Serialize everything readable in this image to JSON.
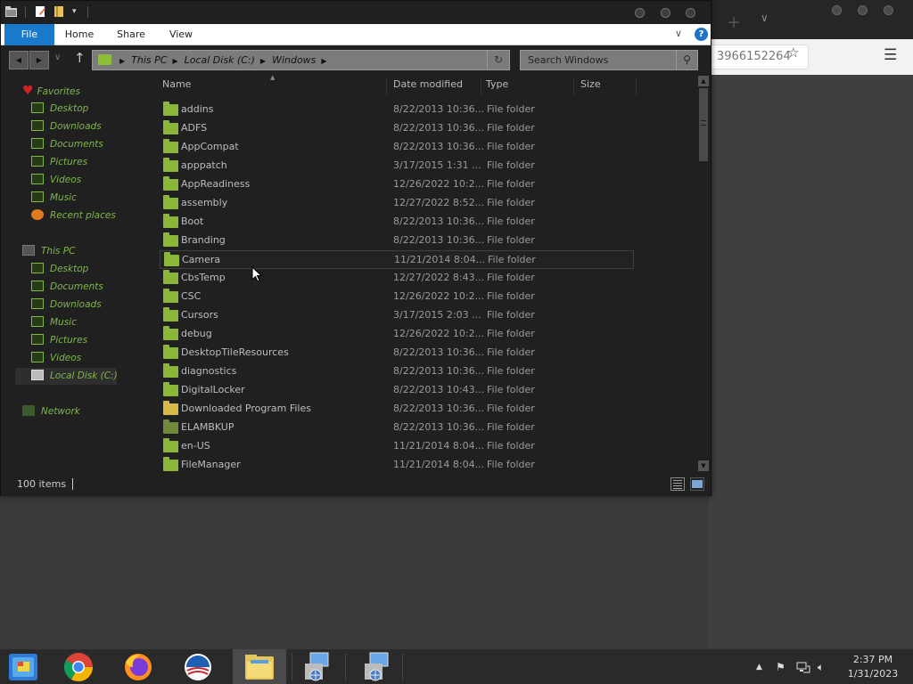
{
  "browser": {
    "url_fragment": "3966152264",
    "new_tab_icon": "plus-icon",
    "tab_list_icon": "chevron-down-icon",
    "bookmark_icon": "star-icon",
    "menu_icon": "hamburger-icon"
  },
  "explorer": {
    "ribbon_tabs": [
      "File",
      "Home",
      "Share",
      "View"
    ],
    "help_label": "?",
    "address": {
      "crumbs": [
        "This PC",
        "Local Disk (C:)",
        "Windows"
      ]
    },
    "search": {
      "placeholder": "Search Windows"
    },
    "nav": {
      "favorites": {
        "label": "Favorites",
        "items": [
          "Desktop",
          "Downloads",
          "Documents",
          "Pictures",
          "Videos",
          "Music",
          "Recent places"
        ]
      },
      "this_pc": {
        "label": "This PC",
        "items": [
          "Desktop",
          "Documents",
          "Downloads",
          "Music",
          "Pictures",
          "Videos",
          "Local Disk (C:)"
        ]
      },
      "network": {
        "label": "Network"
      }
    },
    "columns": {
      "name": "Name",
      "date": "Date modified",
      "type": "Type",
      "size": "Size"
    },
    "files": [
      {
        "name": "addins",
        "date": "8/22/2013 10:36...",
        "type": "File folder",
        "icon": "folder"
      },
      {
        "name": "ADFS",
        "date": "8/22/2013 10:36...",
        "type": "File folder",
        "icon": "folder"
      },
      {
        "name": "AppCompat",
        "date": "8/22/2013 10:36...",
        "type": "File folder",
        "icon": "folder"
      },
      {
        "name": "apppatch",
        "date": "3/17/2015 1:31 ...",
        "type": "File folder",
        "icon": "folder"
      },
      {
        "name": "AppReadiness",
        "date": "12/26/2022 10:2...",
        "type": "File folder",
        "icon": "folder"
      },
      {
        "name": "assembly",
        "date": "12/27/2022 8:52...",
        "type": "File folder",
        "icon": "folder"
      },
      {
        "name": "Boot",
        "date": "8/22/2013 10:36...",
        "type": "File folder",
        "icon": "folder"
      },
      {
        "name": "Branding",
        "date": "8/22/2013 10:36...",
        "type": "File folder",
        "icon": "folder"
      },
      {
        "name": "Camera",
        "date": "11/21/2014 8:04...",
        "type": "File folder",
        "icon": "folder"
      },
      {
        "name": "CbsTemp",
        "date": "12/27/2022 8:43...",
        "type": "File folder",
        "icon": "folder"
      },
      {
        "name": "CSC",
        "date": "12/26/2022 10:2...",
        "type": "File folder",
        "icon": "folder"
      },
      {
        "name": "Cursors",
        "date": "3/17/2015 2:03 ...",
        "type": "File folder",
        "icon": "folder"
      },
      {
        "name": "debug",
        "date": "12/26/2022 10:2...",
        "type": "File folder",
        "icon": "folder"
      },
      {
        "name": "DesktopTileResources",
        "date": "8/22/2013 10:36...",
        "type": "File folder",
        "icon": "folder"
      },
      {
        "name": "diagnostics",
        "date": "8/22/2013 10:36...",
        "type": "File folder",
        "icon": "folder"
      },
      {
        "name": "DigitalLocker",
        "date": "8/22/2013 10:43...",
        "type": "File folder",
        "icon": "folder"
      },
      {
        "name": "Downloaded Program Files",
        "date": "8/22/2013 10:36...",
        "type": "File folder",
        "icon": "special"
      },
      {
        "name": "ELAMBKUP",
        "date": "8/22/2013 10:36...",
        "type": "File folder",
        "icon": "dim"
      },
      {
        "name": "en-US",
        "date": "11/21/2014 8:04...",
        "type": "File folder",
        "icon": "folder"
      },
      {
        "name": "FileManager",
        "date": "11/21/2014 8:04...",
        "type": "File folder",
        "icon": "folder"
      }
    ],
    "hovered_file": "Camera",
    "status": {
      "item_count": "100 items"
    }
  },
  "taskbar": {
    "apps": [
      "start-icon",
      "chrome-icon",
      "firefox-icon",
      "obama-logo-icon",
      "file-explorer-icon",
      "network-setup-icon",
      "network-setup-icon-2"
    ],
    "active_app": "file-explorer-icon",
    "time": "2:37 PM",
    "date": "1/31/2023"
  },
  "colors": {
    "accent_file_tab": "#1979ca",
    "nav_text": "#7fb848",
    "folder": "#8ab63a",
    "window_bg": "#202020",
    "desktop_bg": "#3a3a3a"
  }
}
